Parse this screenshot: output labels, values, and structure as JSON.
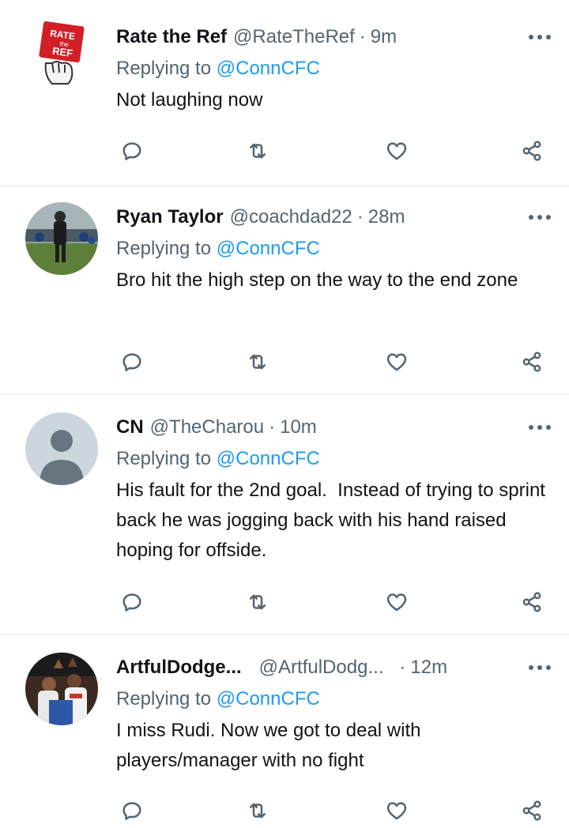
{
  "replying_label": "Replying to",
  "tweets": [
    {
      "name": "Rate the Ref",
      "handle": "@RateTheRef",
      "time": "9m",
      "reply_to": "@ConnCFC",
      "text": "Not laughing now",
      "avatar_text": [
        "RATE",
        "the",
        "REF"
      ]
    },
    {
      "name": "Ryan Taylor",
      "handle": "@coachdad22",
      "time": "28m",
      "reply_to": "@ConnCFC",
      "text": "Bro hit the high step on the way to the end zone"
    },
    {
      "name": "CN",
      "handle": "@TheCharou",
      "time": "10m",
      "reply_to": "@ConnCFC",
      "text": "His fault for the 2nd goal.  Instead of trying to sprint back he was jogging back with his hand raised hoping for offside."
    },
    {
      "name": "ArtfulDodge...",
      "handle": "@ArtfulDodg...",
      "time": "12m",
      "reply_to": "@ConnCFC",
      "text": "I miss Rudi. Now we got to deal with players/manager with no fight"
    }
  ],
  "icons": {
    "reply": "reply-icon",
    "retweet": "retweet-icon",
    "like": "heart-icon",
    "share": "share-icon",
    "more": "more-options-icon"
  },
  "colors": {
    "mention": "#1d9bf0",
    "secondary_text": "#536471",
    "divider": "#eff3f4"
  }
}
